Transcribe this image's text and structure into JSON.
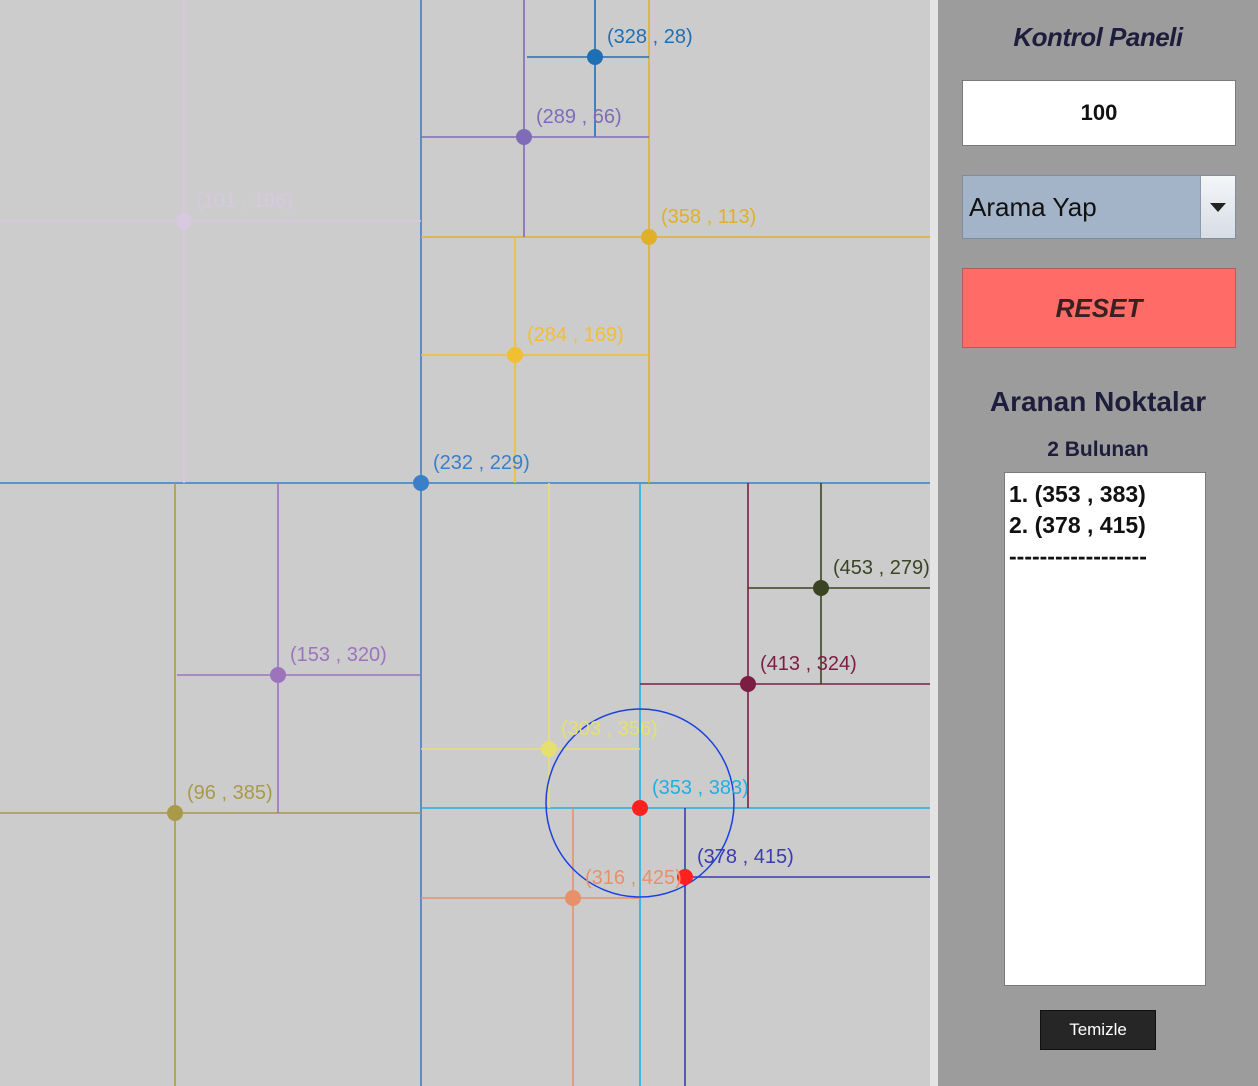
{
  "canvas": {
    "background": "#cccccc",
    "points": [
      {
        "label": "(328 , 28)",
        "color": "#1f6fb4",
        "label_color": "#1f6fb4"
      },
      {
        "label": "(289 , 66)",
        "color": "#7e6cb8",
        "label_color": "#7e6cb8"
      },
      {
        "label": "(101 , 106)",
        "color": "#d8c8e0",
        "label_color": "#d8c8e0"
      },
      {
        "label": "(358 , 113)",
        "color": "#e0b02a",
        "label_color": "#e0b02a"
      },
      {
        "label": "(284 , 169)",
        "color": "#f0c030",
        "label_color": "#f0c030"
      },
      {
        "label": "(232 , 229)",
        "color": "#3b7fc8",
        "label_color": "#3b7fc8"
      },
      {
        "label": "(453 , 279)",
        "color": "#3a4422",
        "label_color": "#3a4422"
      },
      {
        "label": "(153 , 320)",
        "color": "#9c74bc",
        "label_color": "#9c74bc"
      },
      {
        "label": "(413 , 324)",
        "color": "#7c1e44",
        "label_color": "#7c1e44"
      },
      {
        "label": "(303 , 356)",
        "color": "#e6e070",
        "label_color": "#e6e070"
      },
      {
        "label": "(96 , 385)",
        "color": "#a89a48",
        "label_color": "#a89a48"
      },
      {
        "label": "(353 , 383)",
        "color": "#ff2020",
        "label_color": "#20b0e0"
      },
      {
        "label": "(378 , 415)",
        "color": "#ff2020",
        "label_color": "#3a3cb0"
      },
      {
        "label": "(316 , 425)",
        "color": "#e8906a",
        "label_color": "#e8906a"
      }
    ],
    "search_circle_color": "#1a40e0"
  },
  "panel": {
    "title": "Kontrol Paneli",
    "input_value": "100",
    "dropdown_selected": "Arama Yap",
    "reset_label": "RESET",
    "reset_color": "#ff6b66",
    "results_heading": "Aranan Noktalar",
    "found_count": "2 Bulunan",
    "results": [
      "1. (353 , 383)",
      "2. (378 , 415)",
      "------------------"
    ],
    "clear_label": "Temizle"
  }
}
